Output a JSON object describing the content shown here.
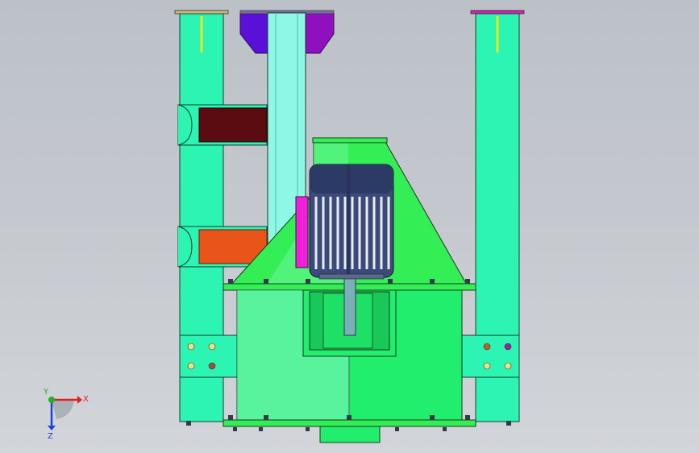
{
  "viewport": {
    "background_top": "#bcc1c8",
    "background_bottom": "#d2d5da"
  },
  "model": {
    "colors": {
      "frame": "#2cf5b4",
      "housing": "#22ee6e",
      "hopper": "#33ee55",
      "column": "#8ef7e6",
      "motor": "#3c4a7a",
      "mount_plate": "#f020d8",
      "beam_upper": "#5a0c10",
      "beam_lower": "#e8541a",
      "chute_left": "#5a10d8",
      "chute_right": "#9010c0",
      "cap_left": "#c8b87a",
      "cap_right": "#d020b0",
      "bolt": "#303c48",
      "edge": "#202a20"
    }
  },
  "triad": {
    "x_label": "X",
    "y_label": "Y",
    "z_label": "Z",
    "x_color": "#e02020",
    "y_color": "#20b020",
    "z_color": "#2040e0"
  }
}
